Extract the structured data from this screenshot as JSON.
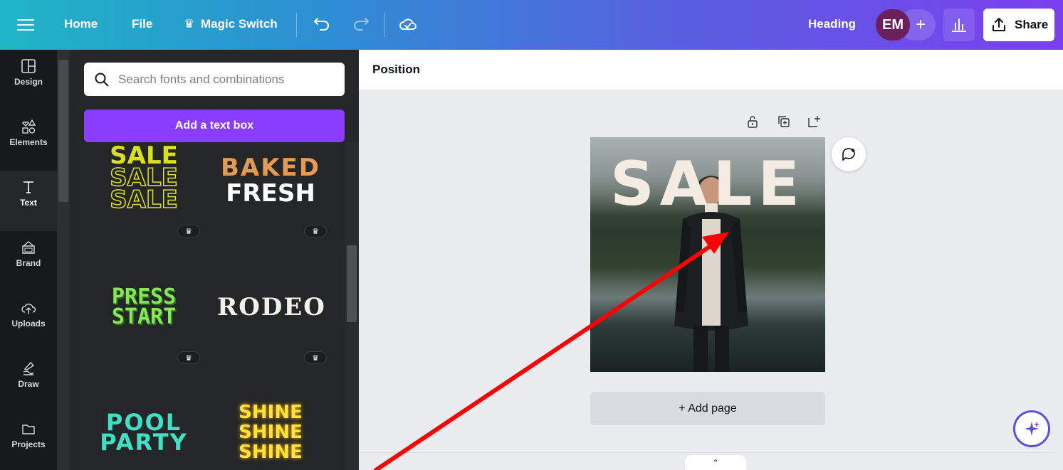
{
  "topbar": {
    "menu_icon": "hamburger-icon",
    "home": "Home",
    "file": "File",
    "magic_switch": "Magic Switch",
    "heading": "Heading",
    "avatar_initials": "EM",
    "add_collaborator": "+",
    "share": "Share"
  },
  "rail": {
    "items": [
      {
        "label": "Design",
        "icon": "layout-icon"
      },
      {
        "label": "Elements",
        "icon": "shapes-icon"
      },
      {
        "label": "Text",
        "icon": "text-icon"
      },
      {
        "label": "Brand",
        "icon": "brand-icon"
      },
      {
        "label": "Uploads",
        "icon": "cloud-upload-icon"
      },
      {
        "label": "Draw",
        "icon": "draw-icon"
      },
      {
        "label": "Projects",
        "icon": "folder-icon"
      }
    ],
    "active": "Text"
  },
  "panel": {
    "search_placeholder": "Search fonts and combinations",
    "add_text_box": "Add a text box",
    "combos": {
      "sale": "SALE",
      "baked": "BAKED",
      "fresh": "FRESH",
      "press": "PRESS",
      "start": "START",
      "rodeo": "RODEO",
      "pool": "POOL",
      "party": "PARTY",
      "shine": "SHINE"
    }
  },
  "editor": {
    "toolbar_label": "Position",
    "design_text": "SALE",
    "add_page": "+ Add page"
  },
  "colors": {
    "accent": "#8b3dff",
    "sale_yellow": "#d9e021",
    "baked_orange": "#e39a57",
    "press_green": "#86e858",
    "pool_teal": "#3fe0c5",
    "shine_yellow": "#ffe23a",
    "annotation_red": "#ff0000"
  }
}
